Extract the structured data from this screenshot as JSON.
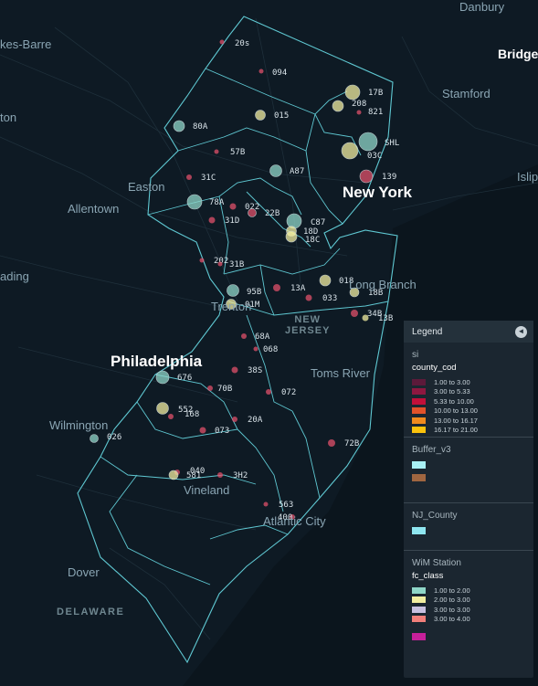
{
  "map": {
    "places": [
      {
        "name": "Danbury",
        "cls": "",
        "id": "place-danbury"
      },
      {
        "name": "Bridge",
        "cls": "white",
        "id": "place-bridgeport"
      },
      {
        "name": "kes-Barre",
        "cls": "",
        "id": "place-wilkes-barre"
      },
      {
        "name": "Stamford",
        "cls": "",
        "id": "place-stamford"
      },
      {
        "name": "ton",
        "cls": "",
        "id": "place-scranton"
      },
      {
        "name": "Islip",
        "cls": "",
        "id": "place-islip"
      },
      {
        "name": "Easton",
        "cls": "",
        "id": "place-easton"
      },
      {
        "name": "New York",
        "cls": "city",
        "id": "place-new-york"
      },
      {
        "name": "Allentown",
        "cls": "",
        "id": "place-allentown"
      },
      {
        "name": "ading",
        "cls": "",
        "id": "place-reading"
      },
      {
        "name": "Long Branch",
        "cls": "",
        "id": "place-long-branch"
      },
      {
        "name": "Trenton",
        "cls": "",
        "id": "place-trenton"
      },
      {
        "name": "NEW\nJERSEY",
        "cls": "state",
        "id": "place-new-jersey"
      },
      {
        "name": "Philadelphia",
        "cls": "city",
        "id": "place-philadelphia"
      },
      {
        "name": "Toms River",
        "cls": "",
        "id": "place-toms-river"
      },
      {
        "name": "Wilmington",
        "cls": "",
        "id": "place-wilmington"
      },
      {
        "name": "Vineland",
        "cls": "",
        "id": "place-vineland"
      },
      {
        "name": "Atlantic City",
        "cls": "",
        "id": "place-atlantic-city"
      },
      {
        "name": "Dover",
        "cls": "",
        "id": "place-dover"
      },
      {
        "name": "DELAWARE",
        "cls": "region",
        "id": "place-delaware"
      }
    ],
    "stations": [
      {
        "label": "20s"
      },
      {
        "label": "094"
      },
      {
        "label": "17B"
      },
      {
        "label": "015"
      },
      {
        "label": "208"
      },
      {
        "label": "821"
      },
      {
        "label": "80A"
      },
      {
        "label": "SHL"
      },
      {
        "label": "57B"
      },
      {
        "label": "03C"
      },
      {
        "label": "A87"
      },
      {
        "label": "139"
      },
      {
        "label": "31C"
      },
      {
        "label": "78A"
      },
      {
        "label": "022"
      },
      {
        "label": "31D"
      },
      {
        "label": "22B"
      },
      {
        "label": "C87"
      },
      {
        "label": "18D"
      },
      {
        "label": "18C"
      },
      {
        "label": "202"
      },
      {
        "label": "31B"
      },
      {
        "label": "018"
      },
      {
        "label": "95B"
      },
      {
        "label": "13A"
      },
      {
        "label": "033"
      },
      {
        "label": "18B"
      },
      {
        "label": "01M"
      },
      {
        "label": "34B"
      },
      {
        "label": "13B"
      },
      {
        "label": "68A"
      },
      {
        "label": "068"
      },
      {
        "label": "676"
      },
      {
        "label": "38S"
      },
      {
        "label": "70B"
      },
      {
        "label": "072"
      },
      {
        "label": "552"
      },
      {
        "label": "168"
      },
      {
        "label": "20A"
      },
      {
        "label": "073"
      },
      {
        "label": "026"
      },
      {
        "label": "72B"
      },
      {
        "label": "040"
      },
      {
        "label": "581"
      },
      {
        "label": "3H2"
      },
      {
        "label": "563"
      },
      {
        "label": "400"
      }
    ]
  },
  "legend": {
    "title": "Legend",
    "sections": [
      {
        "name": "si",
        "field": "county_cod",
        "rows": [
          {
            "color": "#5c1a3a",
            "label": "1.00 to 3.00"
          },
          {
            "color": "#8e1840",
            "label": "3.00 to 5.33"
          },
          {
            "color": "#c2103a",
            "label": "5.33 to 10.00"
          },
          {
            "color": "#e2522a",
            "label": "10.00 to 13.00"
          },
          {
            "color": "#f08a1e",
            "label": "13.00 to 16.17"
          },
          {
            "color": "#fbc20c",
            "label": "16.17 to 21.00"
          }
        ]
      },
      {
        "name": "Buffer_v3",
        "swatches": [
          "#a8f0f4",
          "#a06640"
        ]
      },
      {
        "name": "NJ_County",
        "swatches": [
          "#8fe6f0"
        ]
      },
      {
        "name": "WiM Station",
        "field": "fc_class",
        "rows": [
          {
            "color": "#8fd6c8",
            "label": "1.00 to 2.00"
          },
          {
            "color": "#f2eea0",
            "label": "2.00 to 3.00"
          },
          {
            "color": "#c8c0e0",
            "label": "3.00 to 3.00"
          },
          {
            "color": "#f27f7a",
            "label": "3.00 to 4.00"
          }
        ],
        "extra_swatch": "#c7209a"
      }
    ]
  }
}
